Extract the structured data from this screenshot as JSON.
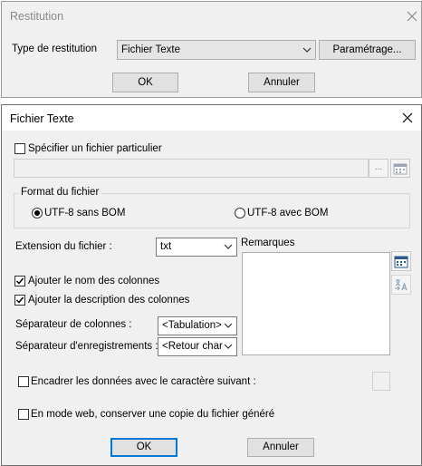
{
  "restitution_window": {
    "title": "Restitution",
    "type_label": "Type de restitution",
    "type_value": "Fichier Texte",
    "parametrage_label": "Paramétrage...",
    "ok_label": "OK",
    "cancel_label": "Annuler"
  },
  "fichier_texte_dialog": {
    "title": "Fichier Texte",
    "specific_file_label": "Spécifier un fichier particulier",
    "specific_file_checked": false,
    "file_path_value": "",
    "browse_label": "...",
    "format_group_title": "Format du fichier",
    "format_options": [
      {
        "label": "UTF-8 sans BOM",
        "selected": true
      },
      {
        "label": "UTF-8 avec BOM",
        "selected": false
      }
    ],
    "extension_label": "Extension du fichier :",
    "extension_value": "txt",
    "remarks_label": "Remarques",
    "remarks_value": "",
    "add_column_names_label": "Ajouter le nom des colonnes",
    "add_column_names_checked": true,
    "add_column_desc_label": "Ajouter la description des colonnes",
    "add_column_desc_checked": true,
    "column_separator_label": "Séparateur de colonnes :",
    "column_separator_value": "<Tabulation>",
    "record_separator_label": "Séparateur d'enregistrements :",
    "record_separator_value": "<Retour char",
    "enclose_label": "Encadrer les données avec le caractère suivant :",
    "enclose_checked": false,
    "web_copy_label": "En mode web, conserver une copie du fichier généré",
    "web_copy_checked": false,
    "ok_label": "OK",
    "cancel_label": "Annuler"
  },
  "colors": {
    "window_bg": "#f0f0f0",
    "accent_border": "#0078d7",
    "check_blue": "#1a5fb4"
  },
  "icons": [
    "close-icon",
    "chevron-down-icon",
    "calendar-icon",
    "translate-icon",
    "checkmark-icon"
  ]
}
